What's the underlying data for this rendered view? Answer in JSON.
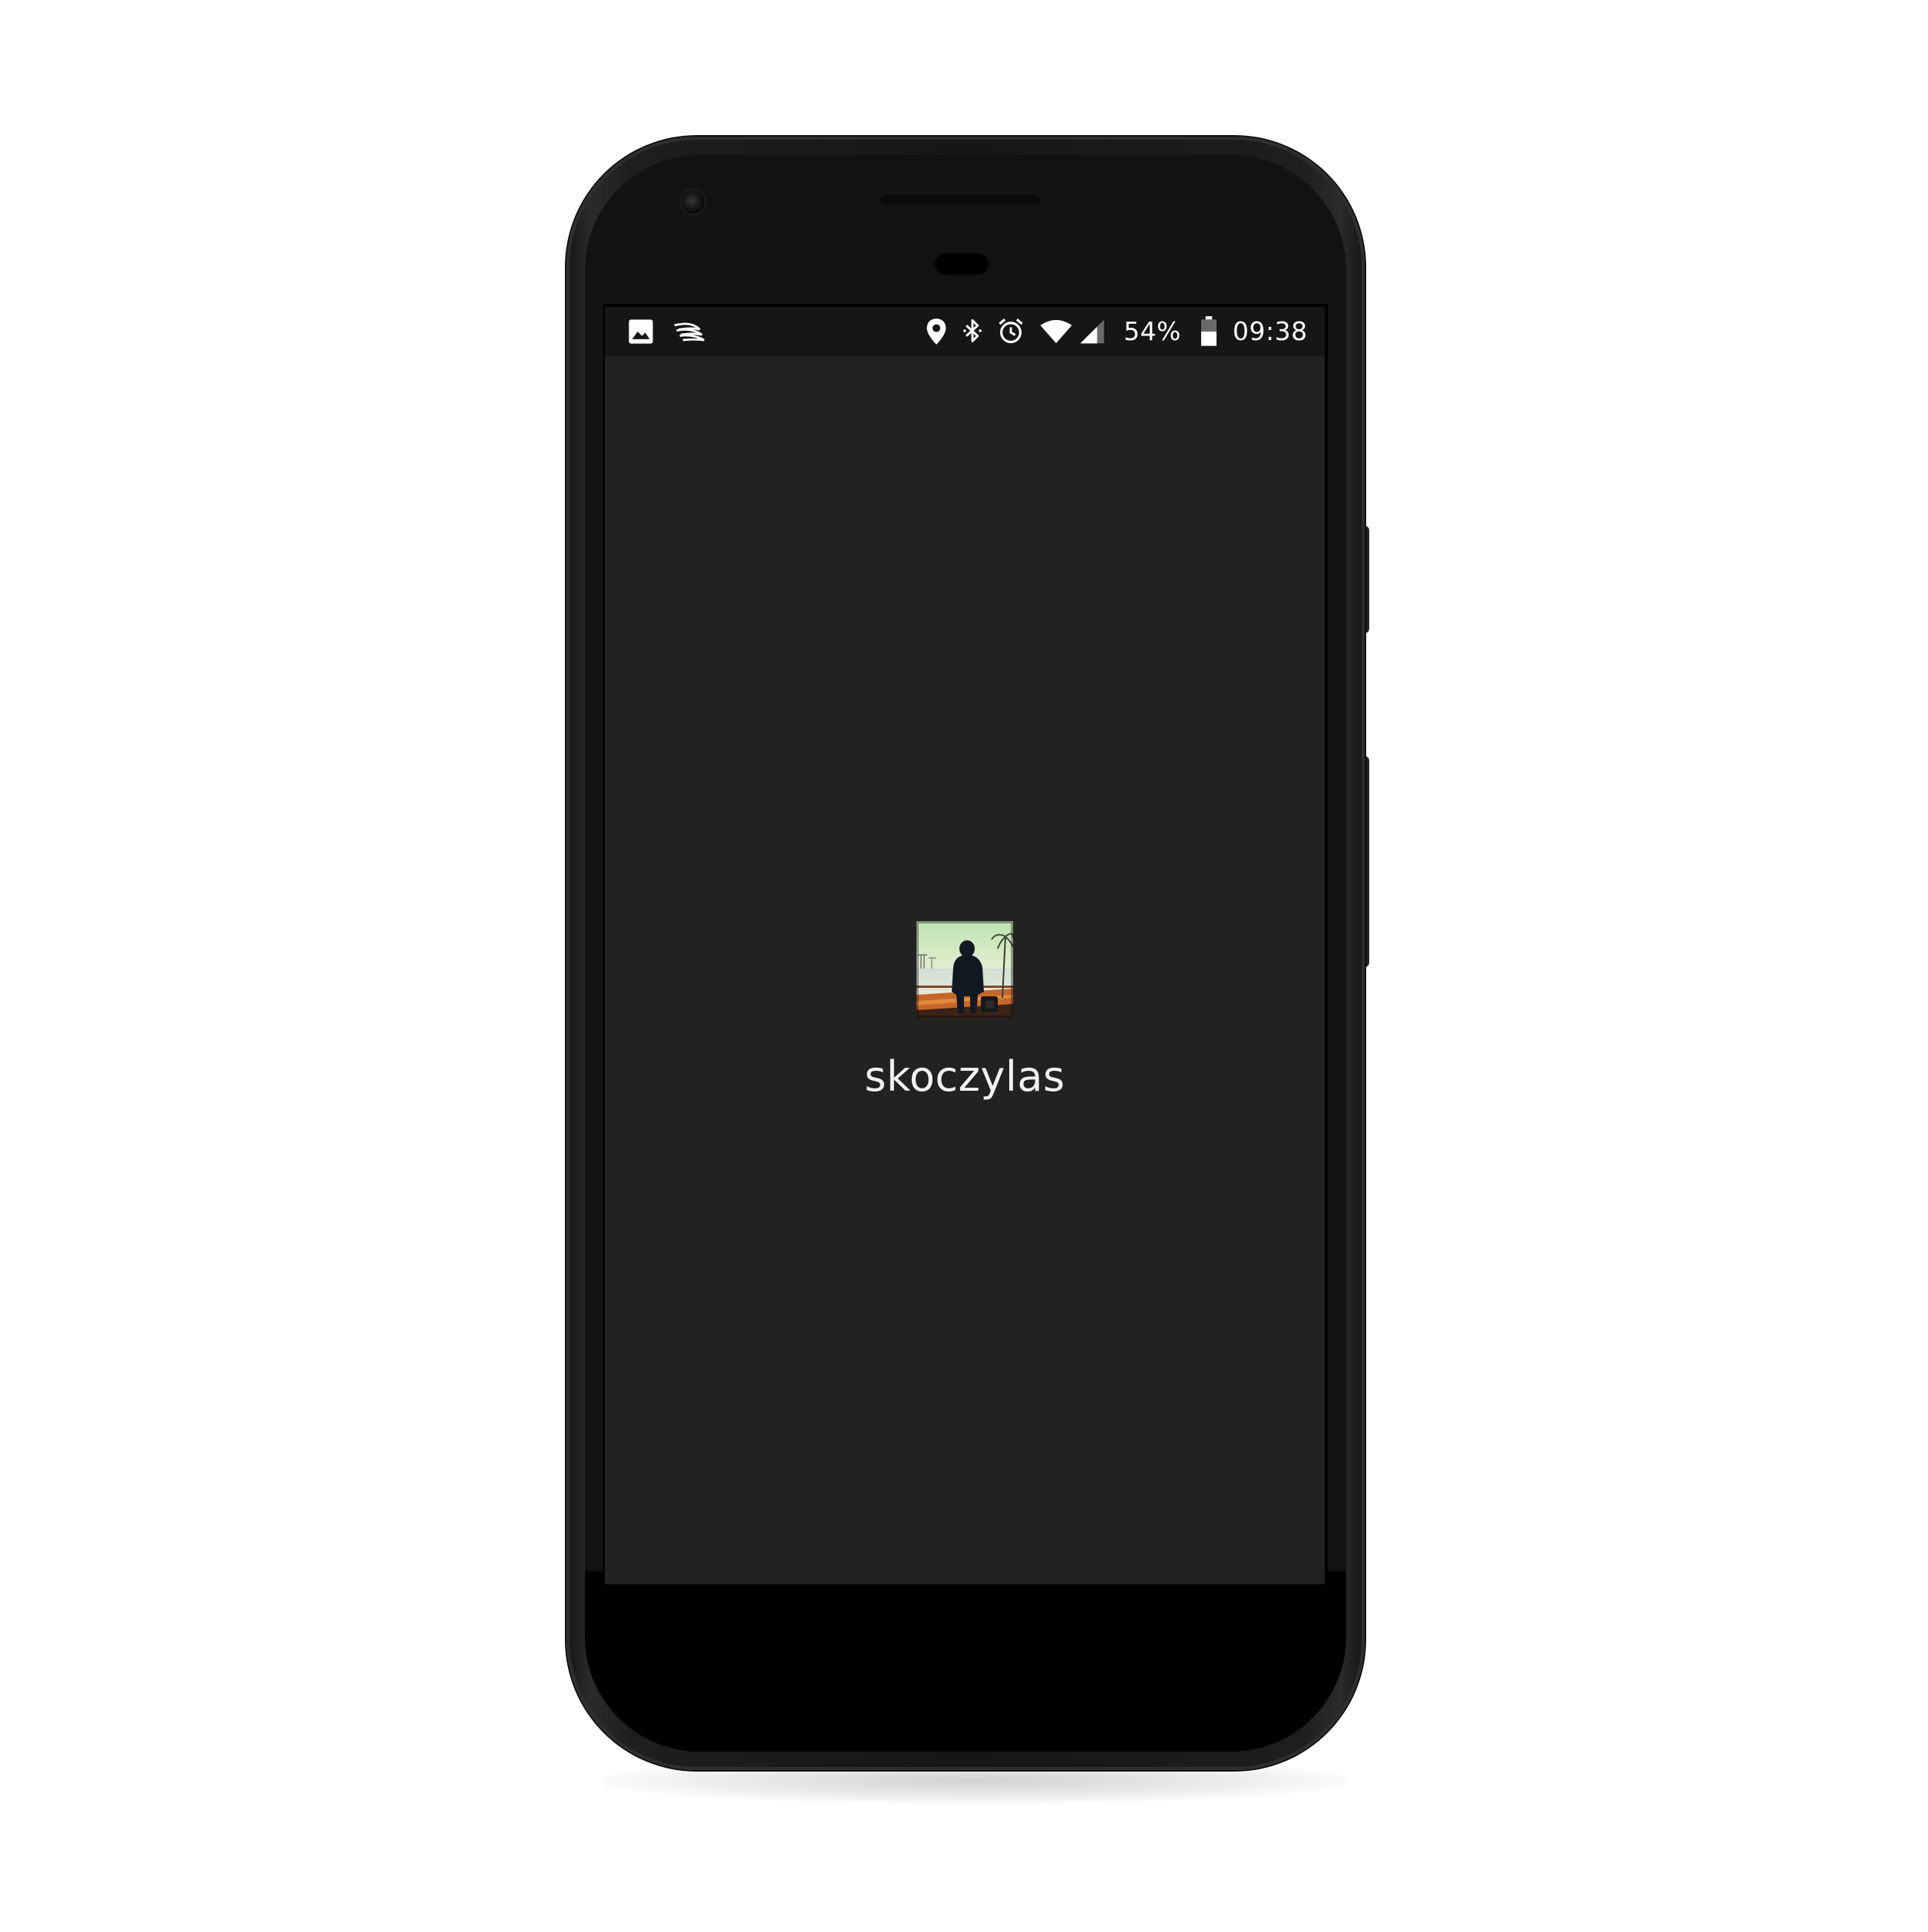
{
  "status_bar": {
    "left_icons": [
      "image-notification-icon",
      "swiftkey-notification-icon"
    ],
    "right_icons": [
      "location-icon",
      "bluetooth-icon",
      "alarm-icon",
      "wifi-icon",
      "cell-signal-icon"
    ],
    "battery_percent": "54%",
    "battery_level": 0.54,
    "time": "09:38"
  },
  "main": {
    "album_art": "album-art-image",
    "artist_name": "skoczylas"
  },
  "colors": {
    "app_background": "#222222",
    "status_bar_background": "#161616",
    "text": "#f2f2f2"
  }
}
